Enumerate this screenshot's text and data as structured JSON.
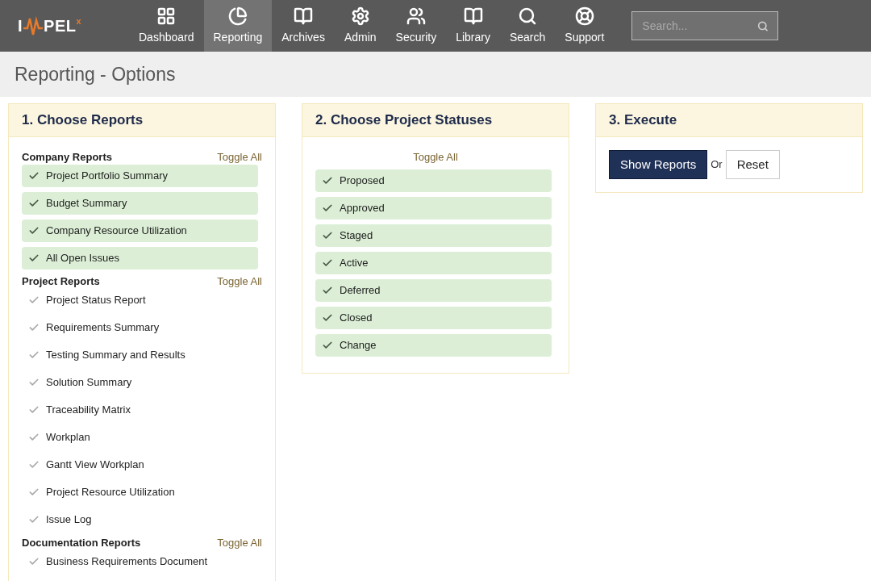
{
  "logo": {
    "first": "I",
    "rest": "PEL",
    "mark": "x"
  },
  "nav": [
    {
      "label": "Dashboard",
      "selected": false
    },
    {
      "label": "Reporting",
      "selected": true
    },
    {
      "label": "Archives",
      "selected": false
    },
    {
      "label": "Admin",
      "selected": false
    },
    {
      "label": "Security",
      "selected": false
    },
    {
      "label": "Library",
      "selected": false
    },
    {
      "label": "Search",
      "selected": false
    },
    {
      "label": "Support",
      "selected": false
    }
  ],
  "search": {
    "placeholder": "Search..."
  },
  "page_title": "Reporting - Options",
  "panels": [
    {
      "title": "1. Choose Reports",
      "groups": [
        {
          "heading": "Company Reports",
          "toggle": "Toggle All",
          "items": [
            {
              "label": "Project Portfolio Summary",
              "checked": true
            },
            {
              "label": "Budget Summary",
              "checked": true
            },
            {
              "label": "Company Resource Utilization",
              "checked": true
            },
            {
              "label": "All Open Issues",
              "checked": true
            }
          ]
        },
        {
          "heading": "Project Reports",
          "toggle": "Toggle All",
          "items": [
            {
              "label": "Project Status Report",
              "checked": false
            },
            {
              "label": "Requirements Summary",
              "checked": false
            },
            {
              "label": "Testing Summary and Results",
              "checked": false
            },
            {
              "label": "Solution Summary",
              "checked": false
            },
            {
              "label": "Traceability Matrix",
              "checked": false
            },
            {
              "label": "Workplan",
              "checked": false
            },
            {
              "label": "Gantt View Workplan",
              "checked": false
            },
            {
              "label": "Project Resource Utilization",
              "checked": false
            },
            {
              "label": "Issue Log",
              "checked": false
            }
          ]
        },
        {
          "heading": "Documentation Reports",
          "toggle": "Toggle All",
          "items": [
            {
              "label": "Business Requirements Document",
              "checked": false
            }
          ]
        }
      ]
    },
    {
      "title": "2. Choose Project Statuses",
      "groups": [
        {
          "toggle": "Toggle All",
          "items": [
            {
              "label": "Proposed",
              "checked": true
            },
            {
              "label": "Approved",
              "checked": true
            },
            {
              "label": "Staged",
              "checked": true
            },
            {
              "label": "Active",
              "checked": true
            },
            {
              "label": "Deferred",
              "checked": true
            },
            {
              "label": "Closed",
              "checked": true
            },
            {
              "label": "Change",
              "checked": true
            }
          ]
        }
      ]
    },
    {
      "title": "3. Execute",
      "actions": {
        "primary": "Show Reports",
        "separator": "Or",
        "secondary": "Reset"
      }
    }
  ]
}
